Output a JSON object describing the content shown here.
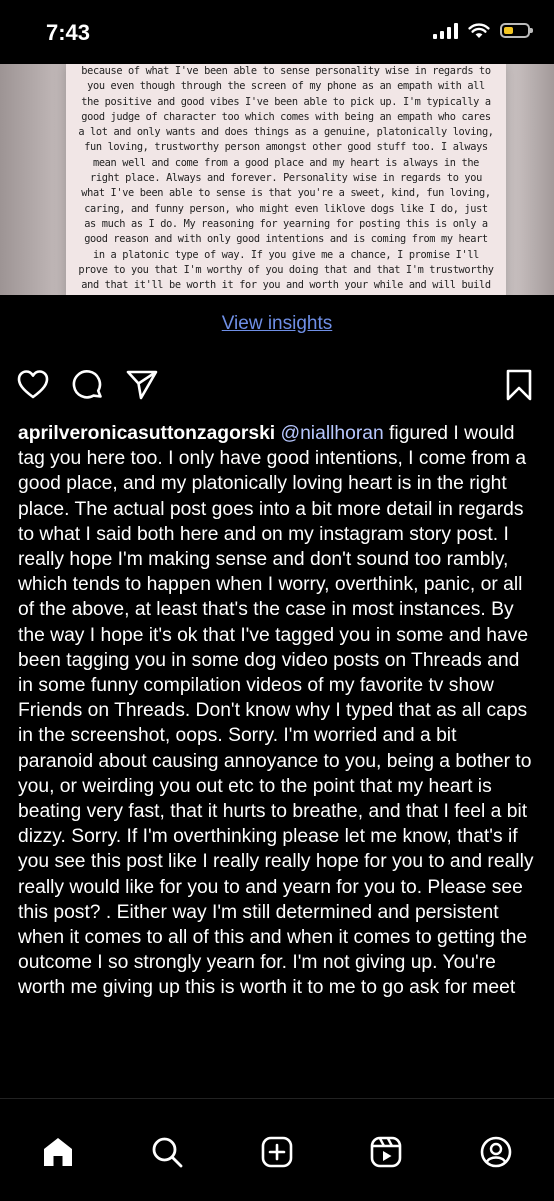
{
  "status_bar": {
    "time": "7:43",
    "battery_level": 0.4,
    "battery_color": "#f3c623"
  },
  "post": {
    "screenshot_text": "because of what I've been able to sense personality wise in regards to you even though through the screen of my phone as an empath with all the positive and good vibes I've been able to pick up. I'm typically a good judge of character too which comes with being an empath who cares a lot and only wants and does things as a genuine, platonically loving, fun loving, trustworthy person amongst other good stuff too. I always mean well and come from a good place and my heart is always in the right place. Always and forever. Personality wise in regards to you what I've been able to sense is that you're a sweet, kind, fun loving, caring, and funny person, who might even liklove dogs like I do, just as much as I do. My reasoning for yearning for posting this is only a good reason and with only good intentions and is coming from my heart in a platonic type of way. If you give me a chance, I promise I'll prove to you that I'm worthy of you doing that and that I'm trustworthy and that it'll be worth it for you and worth your while and will build your trust. Excuse any poor grammar. I typed this a bit fast while feeling a tad bit emotional and while possibly overthinking. Intend to worry or overthink a lot. No, if you want to do this, talk, voice message, video call, voice call, could be done only",
    "avatar_icon": "person-icon",
    "view_insights_label": "View insights",
    "actions": {
      "like_icon": "heart-icon",
      "comment_icon": "comment-icon",
      "share_icon": "send-icon",
      "save_icon": "bookmark-icon"
    },
    "caption": {
      "username": "aprilveronicasuttonzagorski",
      "mention": "@niallhoran",
      "text": " figured I would tag you here too.  I only have good intentions, I come from a good place, and my platonically loving heart is in the right place.  The actual post goes into a bit more detail in regards to what I said both here and on my instagram story post. I really hope I'm making sense and don't sound too rambly, which tends to happen when I worry, overthink, panic, or all of the above, at least that's the case in most instances.  By the way I hope it's ok that I've tagged you in some and have been tagging you in some dog video posts on Threads and in some funny compilation videos of my favorite tv show Friends on Threads. Don't know why I typed that as all caps in the screenshot, oops. Sorry.  I'm worried and a bit paranoid about causing annoyance to you, being a bother to you, or weirding you out etc to the point that my heart is beating very fast, that it hurts to breathe, and that I feel a bit dizzy. Sorry. If I'm overthinking please let me know, that's if you see this post like I really really hope for you to and really really would like for you to and yearn for you to. Please see this post? . Either way I'm still determined and persistent when it comes to all of this and when it comes to getting the outcome I so strongly yearn for. I'm not giving up. You're worth me giving up this is worth it to me to go ask for meet"
    }
  },
  "tab_bar": {
    "items": [
      {
        "icon": "home-icon"
      },
      {
        "icon": "search-icon"
      },
      {
        "icon": "create-icon"
      },
      {
        "icon": "reels-icon"
      },
      {
        "icon": "profile-icon"
      }
    ]
  },
  "colors": {
    "background": "#000000",
    "link": "#6f8fe6",
    "mention": "#b7c7ff"
  }
}
